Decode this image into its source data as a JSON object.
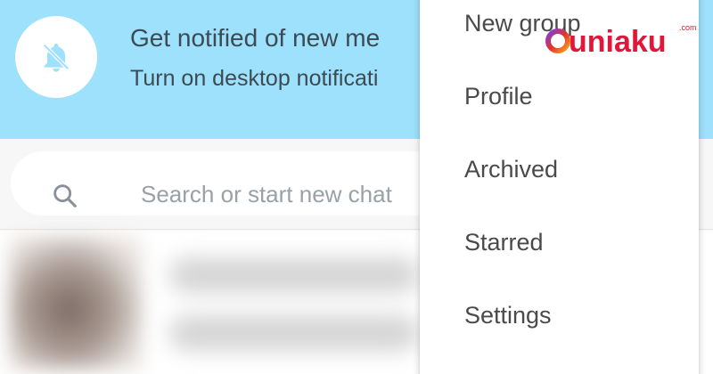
{
  "banner": {
    "icon": "bell-off-icon",
    "title": "Get notified of new me",
    "subtitle": "Turn on desktop notificati",
    "color": "#9de1fd"
  },
  "search": {
    "icon": "search-icon",
    "placeholder": "Search or start new chat"
  },
  "menu": {
    "items": [
      {
        "label": "New group"
      },
      {
        "label": "Profile"
      },
      {
        "label": "Archived"
      },
      {
        "label": "Starred"
      },
      {
        "label": "Settings"
      }
    ]
  },
  "watermark": {
    "text": "duniaku",
    "suffix": ".com"
  }
}
